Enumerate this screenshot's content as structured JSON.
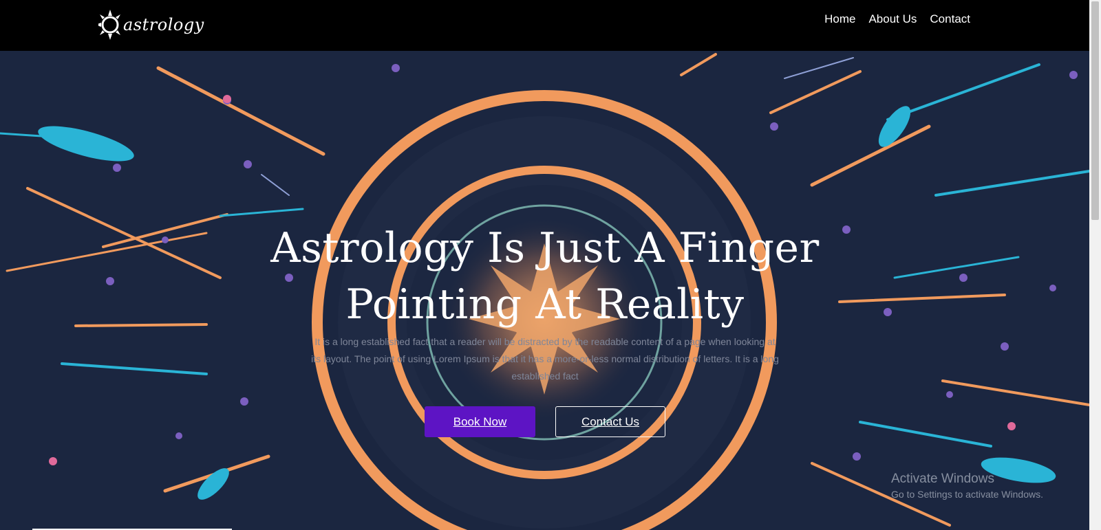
{
  "brand": {
    "logo_text": "astrology"
  },
  "nav": {
    "items": [
      "Home",
      "About Us",
      "Contact"
    ]
  },
  "hero": {
    "title_line1": "Astrology Is Just A Finger",
    "title_line2": "Pointing At Reality",
    "subtitle": "It is a long established fact that a reader will be distracted by the readable content of a page when looking at its layout. The point of using Lorem Ipsum is that it has a more-or-less normal distribution of letters. It is a long established fact",
    "book_label": "Book Now",
    "contact_label": "Contact Us"
  },
  "watermark": {
    "title": "Activate Windows",
    "subtitle": "Go to Settings to activate Windows."
  },
  "colors": {
    "accent": "#5d14c4",
    "navbar": "#000000",
    "hero_bg": "#1a2339",
    "ring": "#f19a5d",
    "streak_cyan": "#2ab4d6"
  },
  "icons": {
    "logo": "sun-icon"
  }
}
